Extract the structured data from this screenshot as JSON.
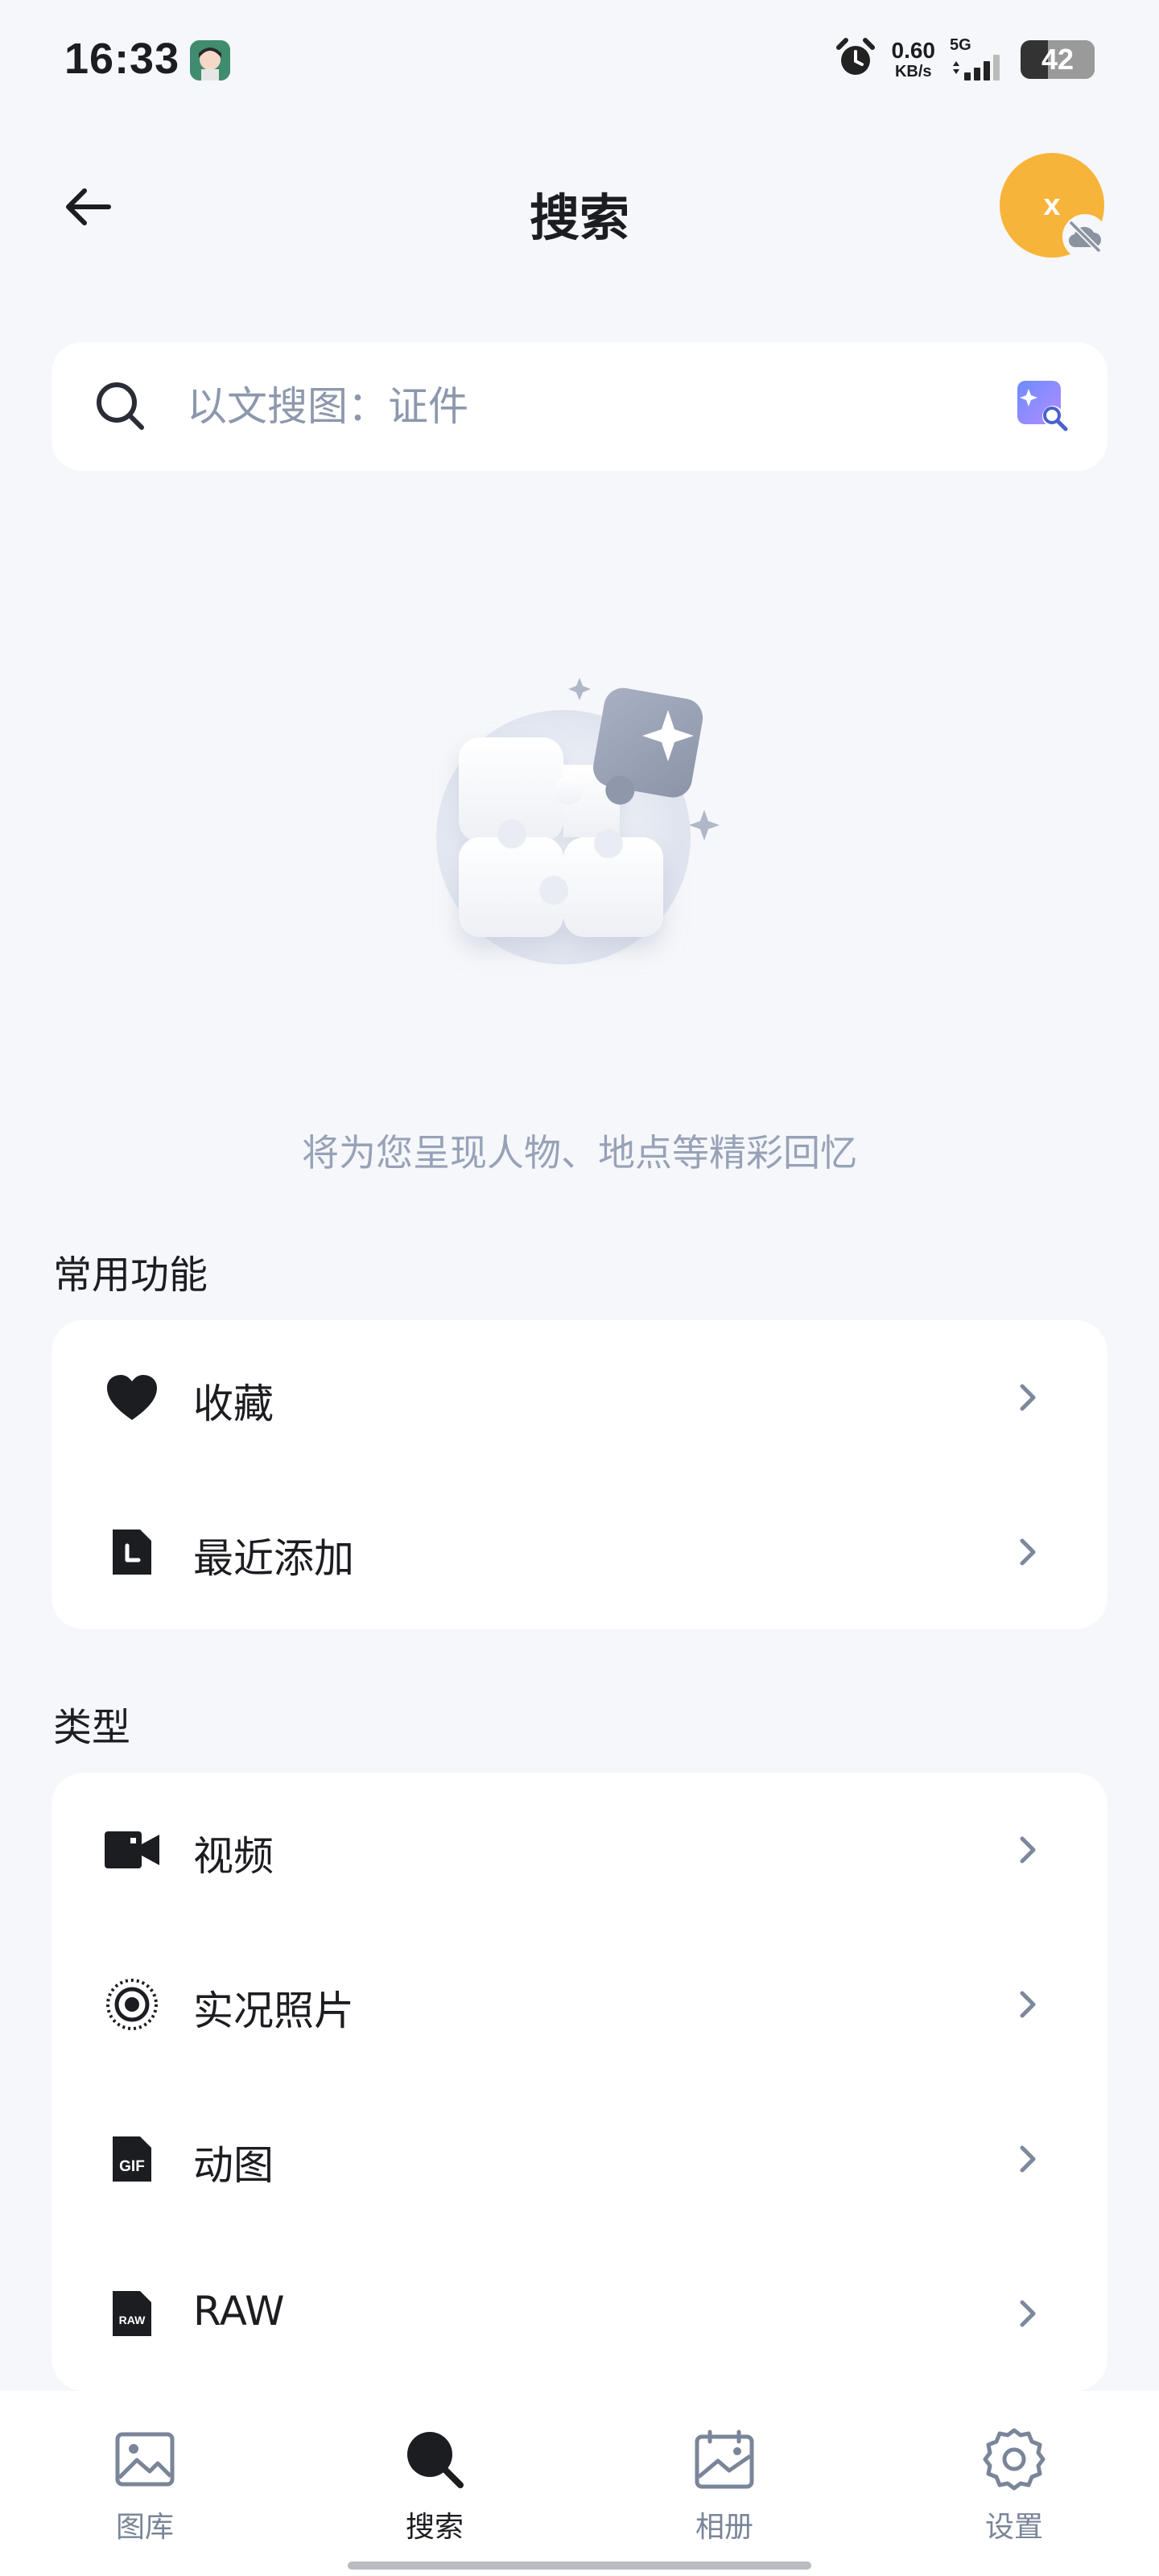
{
  "status_bar": {
    "time": "16:33",
    "net_speed_value": "0.60",
    "net_speed_unit": "KB/s",
    "network_type": "5G",
    "battery_level": "42",
    "icons": [
      "avatar-notification-icon",
      "alarm-icon",
      "signal-icon",
      "battery-icon"
    ]
  },
  "header": {
    "title": "搜索",
    "account_initial": "x",
    "icons": [
      "back-arrow-icon",
      "cloud-off-icon"
    ]
  },
  "search": {
    "placeholder": "以文搜图：证件",
    "value": "",
    "icons": [
      "search-icon",
      "ai-image-search-icon"
    ]
  },
  "empty_state": {
    "hint": "将为您呈现人物、地点等精彩回忆",
    "illustration": "puzzle-sparkle-illustration"
  },
  "sections": [
    {
      "title": "常用功能",
      "items": [
        {
          "label": "收藏",
          "icon": "heart-icon"
        },
        {
          "label": "最近添加",
          "icon": "recent-file-icon"
        }
      ]
    },
    {
      "title": "类型",
      "items": [
        {
          "label": "视频",
          "icon": "video-camera-icon"
        },
        {
          "label": "实况照片",
          "icon": "live-photo-icon"
        },
        {
          "label": "动图",
          "icon": "gif-icon"
        },
        {
          "label": "RAW",
          "icon": "raw-icon"
        }
      ]
    }
  ],
  "bottom_nav": {
    "items": [
      {
        "label": "图库",
        "icon": "gallery-icon",
        "active": false
      },
      {
        "label": "搜索",
        "icon": "search-icon",
        "active": true
      },
      {
        "label": "相册",
        "icon": "album-icon",
        "active": false
      },
      {
        "label": "设置",
        "icon": "settings-gear-icon",
        "active": false
      }
    ]
  },
  "colors": {
    "background": "#f6f7fa",
    "card": "#ffffff",
    "text_primary": "#1c1d21",
    "text_hint": "#97a2b8",
    "nav_inactive": "#7a8599",
    "account_accent": "#f7b43a"
  }
}
